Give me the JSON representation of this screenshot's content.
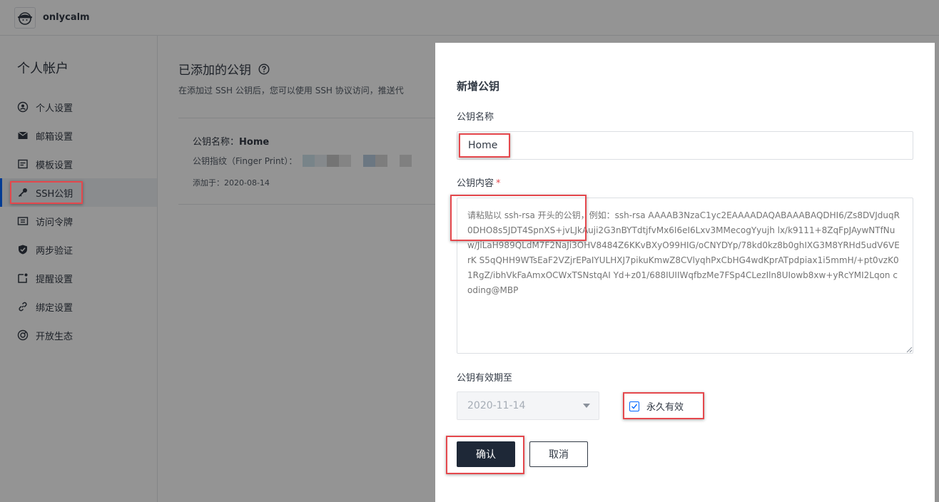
{
  "topbar": {
    "brand": "onlycalm"
  },
  "sidebar": {
    "title": "个人帐户",
    "items": [
      {
        "label": "个人设置",
        "icon": "user-circle-icon"
      },
      {
        "label": "邮箱设置",
        "icon": "mail-icon"
      },
      {
        "label": "模板设置",
        "icon": "template-icon"
      },
      {
        "label": "SSH公钥",
        "icon": "key-icon",
        "active": true
      },
      {
        "label": "访问令牌",
        "icon": "ticket-icon"
      },
      {
        "label": "两步验证",
        "icon": "shield-icon"
      },
      {
        "label": "提醒设置",
        "icon": "reminder-icon"
      },
      {
        "label": "绑定设置",
        "icon": "link-icon"
      },
      {
        "label": "开放生态",
        "icon": "ecosystem-icon"
      }
    ]
  },
  "main": {
    "title": "已添加的公钥",
    "desc": "在添加过 SSH 公钥后，您可以使用 SSH 协议访问，推送代",
    "key": {
      "name_label": "公钥名称：",
      "name_value": "Home",
      "fp_label": "公钥指纹（Finger Print）：",
      "date": "添加于：2020-08-14"
    }
  },
  "dialog": {
    "title": "新增公钥",
    "name_label": "公钥名称",
    "name_value": "Home",
    "content_label": "公钥内容",
    "content_required": "*",
    "content_placeholder": "请粘贴以 ssh-rsa 开头的公钥，例如：ssh-rsa AAAAB3NzaC1yc2EAAAADAQABAAABAQDHI6/Zs8DVJduqR0DHO8s5JDT4SpnXS+jvLJkAuji2G3nBYTdtjfvMx6I6eI6Lxv3MMecogYyujh lx/k9111+8ZqFpJAywNTfNuw/JiLaH989QLdM7F2NaJi3OHV8484Z6KKvBXyO99HIG/oCNYDYp/78kd0kz8b0ghIXG3M8YRHd5udV6VErK S5qQHH9WTsEaF2VZjrEPaIYULHXJ7pikuKmwZ8CVlyqhPxCbHG4wdKprATpdpiax1i5mmH/+pt0vzK01RgZ/ibhVkFaAmxOCWxTSNstqAI Yd+z01/688IUIIWqfbzMe7FSp4CLezIln8UIowb8xw+yRcYMI2Lqon coding@MBP",
    "expire_label": "公钥有效期至",
    "expire_value": "2020-11-14",
    "permanent_label": "永久有效",
    "confirm_label": "确认",
    "cancel_label": "取消"
  },
  "colors": {
    "accent": "#0066ff",
    "dark_button": "#1e2837",
    "highlight": "#e5484d"
  }
}
